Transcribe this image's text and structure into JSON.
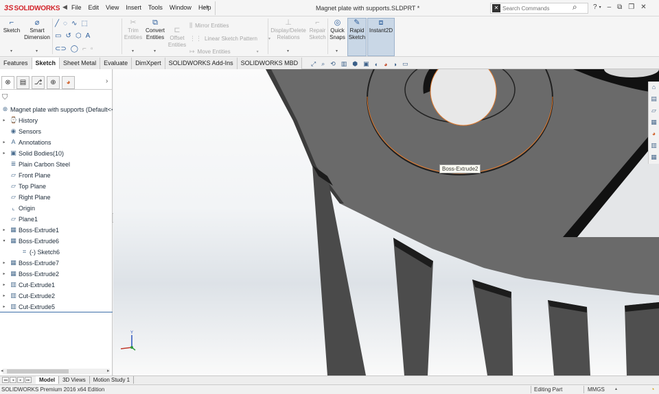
{
  "app": {
    "logo_prefix": "3S",
    "logo_name": "SOLIDWORKS",
    "document_title": "Magnet plate with supports.SLDPRT *"
  },
  "menu": [
    "File",
    "Edit",
    "View",
    "Insert",
    "Tools",
    "Window",
    "Help"
  ],
  "search": {
    "placeholder": "Search Commands"
  },
  "ribbon": {
    "sketch": "Sketch",
    "smart_dimension_1": "Smart",
    "smart_dimension_2": "Dimension",
    "trim_1": "Trim",
    "trim_2": "Entities",
    "convert_1": "Convert",
    "convert_2": "Entities",
    "offset_1": "Offset",
    "offset_2": "Entities",
    "mirror": "Mirror Entities",
    "linear_pattern": "Linear Sketch Pattern",
    "move": "Move Entities",
    "display_delete_1": "Display/Delete",
    "display_delete_2": "Relations",
    "repair_1": "Repair",
    "repair_2": "Sketch",
    "quick_snaps_1": "Quick",
    "quick_snaps_2": "Snaps",
    "rapid_sketch_1": "Rapid",
    "rapid_sketch_2": "Sketch",
    "instant2d": "Instant2D"
  },
  "tabs": [
    "Features",
    "Sketch",
    "Sheet Metal",
    "Evaluate",
    "DimXpert",
    "SOLIDWORKS Add-Ins",
    "SOLIDWORKS MBD"
  ],
  "active_tab": "Sketch",
  "tree": {
    "root": "Magnet plate with supports  (Default<<",
    "items": [
      {
        "label": "History",
        "icon": "history-icon",
        "expand": true
      },
      {
        "label": "Sensors",
        "icon": "sensor-icon",
        "expand": false
      },
      {
        "label": "Annotations",
        "icon": "annotations-icon",
        "expand": true
      },
      {
        "label": "Solid Bodies(10)",
        "icon": "solid-bodies-icon",
        "expand": true
      },
      {
        "label": "Plain Carbon Steel",
        "icon": "material-icon",
        "expand": false
      },
      {
        "label": "Front Plane",
        "icon": "plane-icon",
        "expand": false
      },
      {
        "label": "Top Plane",
        "icon": "plane-icon",
        "expand": false
      },
      {
        "label": "Right Plane",
        "icon": "plane-icon",
        "expand": false
      },
      {
        "label": "Origin",
        "icon": "origin-icon",
        "expand": false
      },
      {
        "label": "Plane1",
        "icon": "plane-icon",
        "expand": false
      },
      {
        "label": "Boss-Extrude1",
        "icon": "extrude-icon",
        "expand": true
      },
      {
        "label": "Boss-Extrude6",
        "icon": "extrude-icon",
        "expand": true,
        "open": true
      },
      {
        "label": "(-) Sketch6",
        "icon": "sketch-icon",
        "expand": false,
        "child": true
      },
      {
        "label": "Boss-Extrude7",
        "icon": "extrude-icon",
        "expand": true
      },
      {
        "label": "Boss-Extrude2",
        "icon": "extrude-icon",
        "expand": true
      },
      {
        "label": "Cut-Extrude1",
        "icon": "cut-extrude-icon",
        "expand": true
      },
      {
        "label": "Cut-Extrude2",
        "icon": "cut-extrude-icon",
        "expand": true
      },
      {
        "label": "Cut-Extrude5",
        "icon": "cut-extrude-icon",
        "expand": true
      }
    ]
  },
  "viewport": {
    "tooltip": "Boss-Extrude2",
    "triad_y": "Y"
  },
  "bottom_tabs": [
    "Model",
    "3D Views",
    "Motion Study 1"
  ],
  "status": {
    "product": "SOLIDWORKS Premium 2016 x64 Edition",
    "mode": "Editing Part",
    "units": "MMGS"
  },
  "colors": {
    "brand": "#d2232a",
    "part_face": "#6b6b6b",
    "part_dark": "#1a1a1a",
    "selection_edge": "#e07a2e"
  }
}
